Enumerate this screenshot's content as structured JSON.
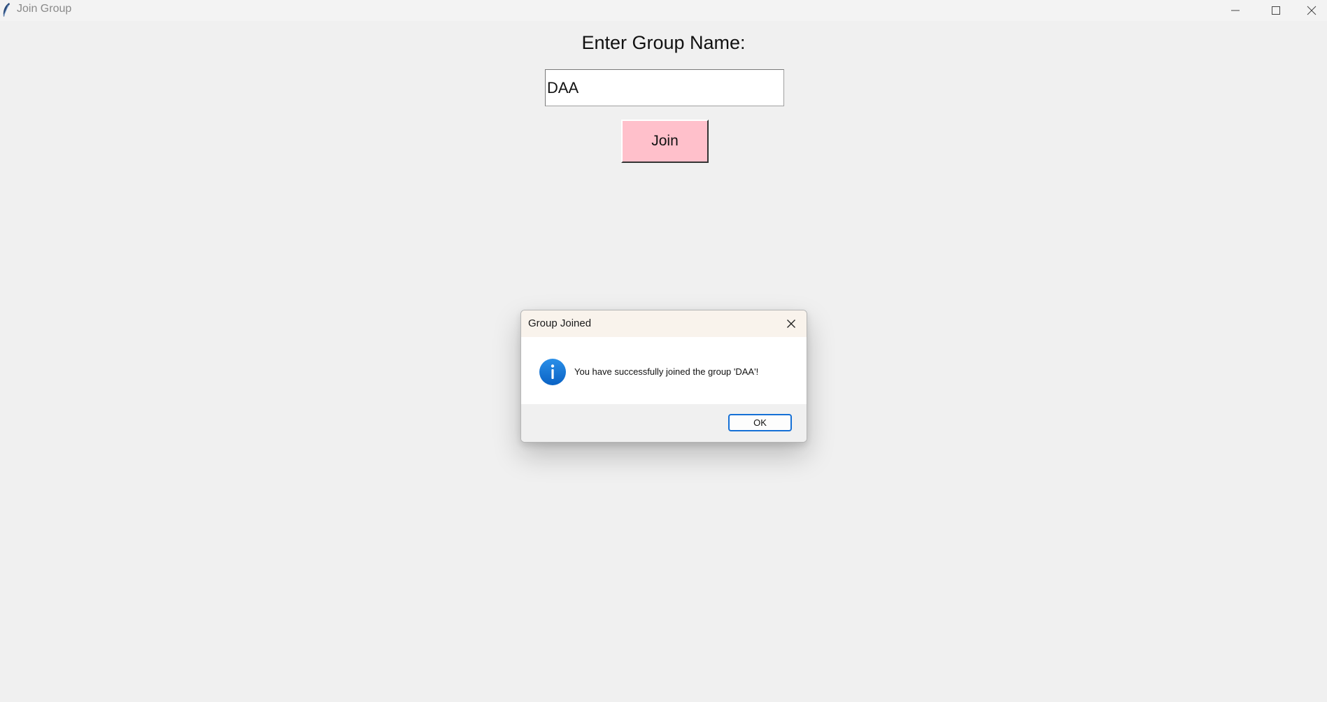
{
  "window": {
    "title": "Join Group",
    "icon": "feather-icon"
  },
  "main": {
    "heading": "Enter Group Name:",
    "group_input_value": "DAA",
    "join_label": "Join",
    "join_button_color": "#ffc0cb"
  },
  "dialog": {
    "title": "Group Joined",
    "message": "You have successfully joined the group 'DAA'!",
    "icon": "info-icon",
    "ok_label": "OK",
    "accent": "#1570d6"
  }
}
